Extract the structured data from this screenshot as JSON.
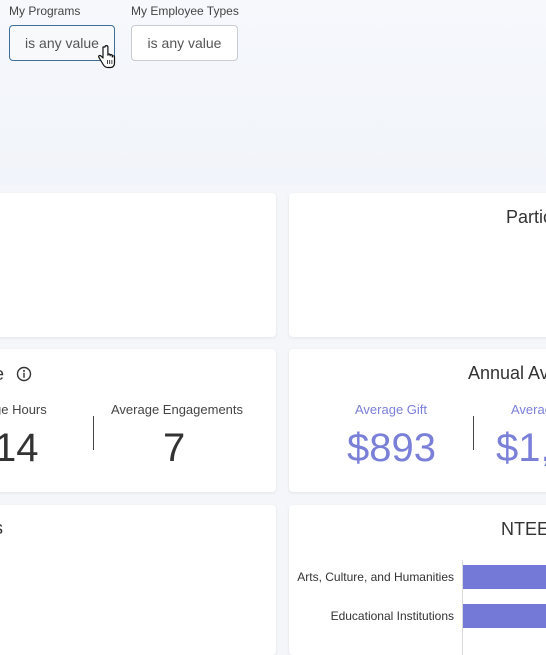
{
  "filters": [
    {
      "label": "My Programs",
      "value": "is any value"
    },
    {
      "label": "My Employee Types",
      "value": "is any value"
    }
  ],
  "cards": {
    "top_right_title": "Partic",
    "engagement": {
      "title_partial": "e",
      "info_icon": "info-icon",
      "metric1": {
        "label": "ge Hours",
        "value": "14"
      },
      "metric2": {
        "label": "Average Engagements",
        "value": "7"
      }
    },
    "annual": {
      "title": "Annual Av",
      "metric1": {
        "label": "Average Gift",
        "value": "$893"
      },
      "metric2": {
        "label": "Averag",
        "value": "$1,"
      }
    },
    "bottom_left_title": "s",
    "ntee": {
      "title": "NTEE",
      "bars": [
        {
          "label": "Arts, Culture, and Humanities"
        },
        {
          "label": "Educational Institutions"
        }
      ]
    }
  },
  "colors": {
    "accent": "#7a7fd8",
    "bar": "#7479d8",
    "active_border": "#3f6f96"
  }
}
